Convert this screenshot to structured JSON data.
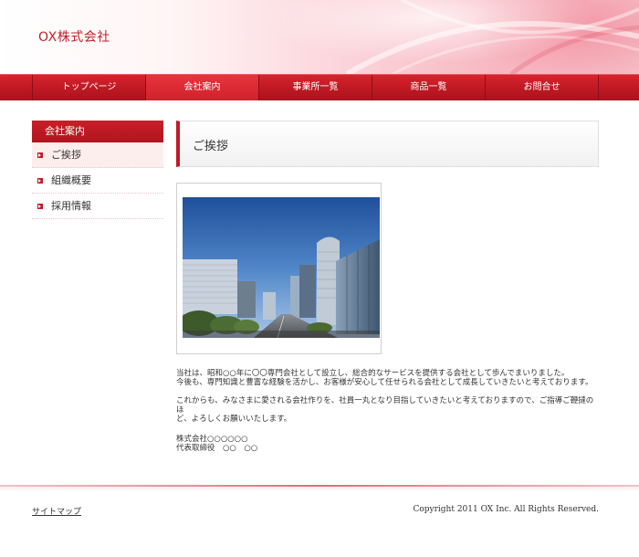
{
  "header": {
    "site_title": "OX株式会社"
  },
  "nav": {
    "items": [
      {
        "label": "トップページ"
      },
      {
        "label": "会社案内"
      },
      {
        "label": "事業所一覧"
      },
      {
        "label": "商品一覧"
      },
      {
        "label": "お問合せ"
      }
    ],
    "active": "会社案内"
  },
  "sidebar": {
    "heading": "会社案内",
    "items": [
      {
        "label": "ご挨拶"
      },
      {
        "label": "組織概要"
      },
      {
        "label": "採用情報"
      }
    ],
    "active": "ご挨拶"
  },
  "main": {
    "heading": "ご挨拶",
    "paragraphs": [
      {
        "lines": [
          "当社は、昭和○○年に〇〇専門会社として設立し、総合的なサービスを提供する会社として歩んでまいりました。",
          "今後も、専門知識と豊富な経験を活かし、お客様が安心して任せられる会社として成長していきたいと考えております。"
        ]
      },
      {
        "lines": [
          "これからも、みなさまに愛される会社作りを、社員一丸となり目指していきたいと考えておりますので、ご指導ご鞭撻のほ",
          "ど、よろしくお願いいたします。"
        ]
      },
      {
        "lines": [
          "株式会社○○○○○○",
          "代表取締役　○○　○○"
        ]
      }
    ]
  },
  "footer": {
    "sitemap_label": "サイトマップ",
    "copyright": "Copyright 2011 OX Inc. All Rights Reserved."
  },
  "colors": {
    "accent": "#c01a24",
    "nav_bg": "#c01a24",
    "sidebar_active_bg": "#fdeeee"
  }
}
